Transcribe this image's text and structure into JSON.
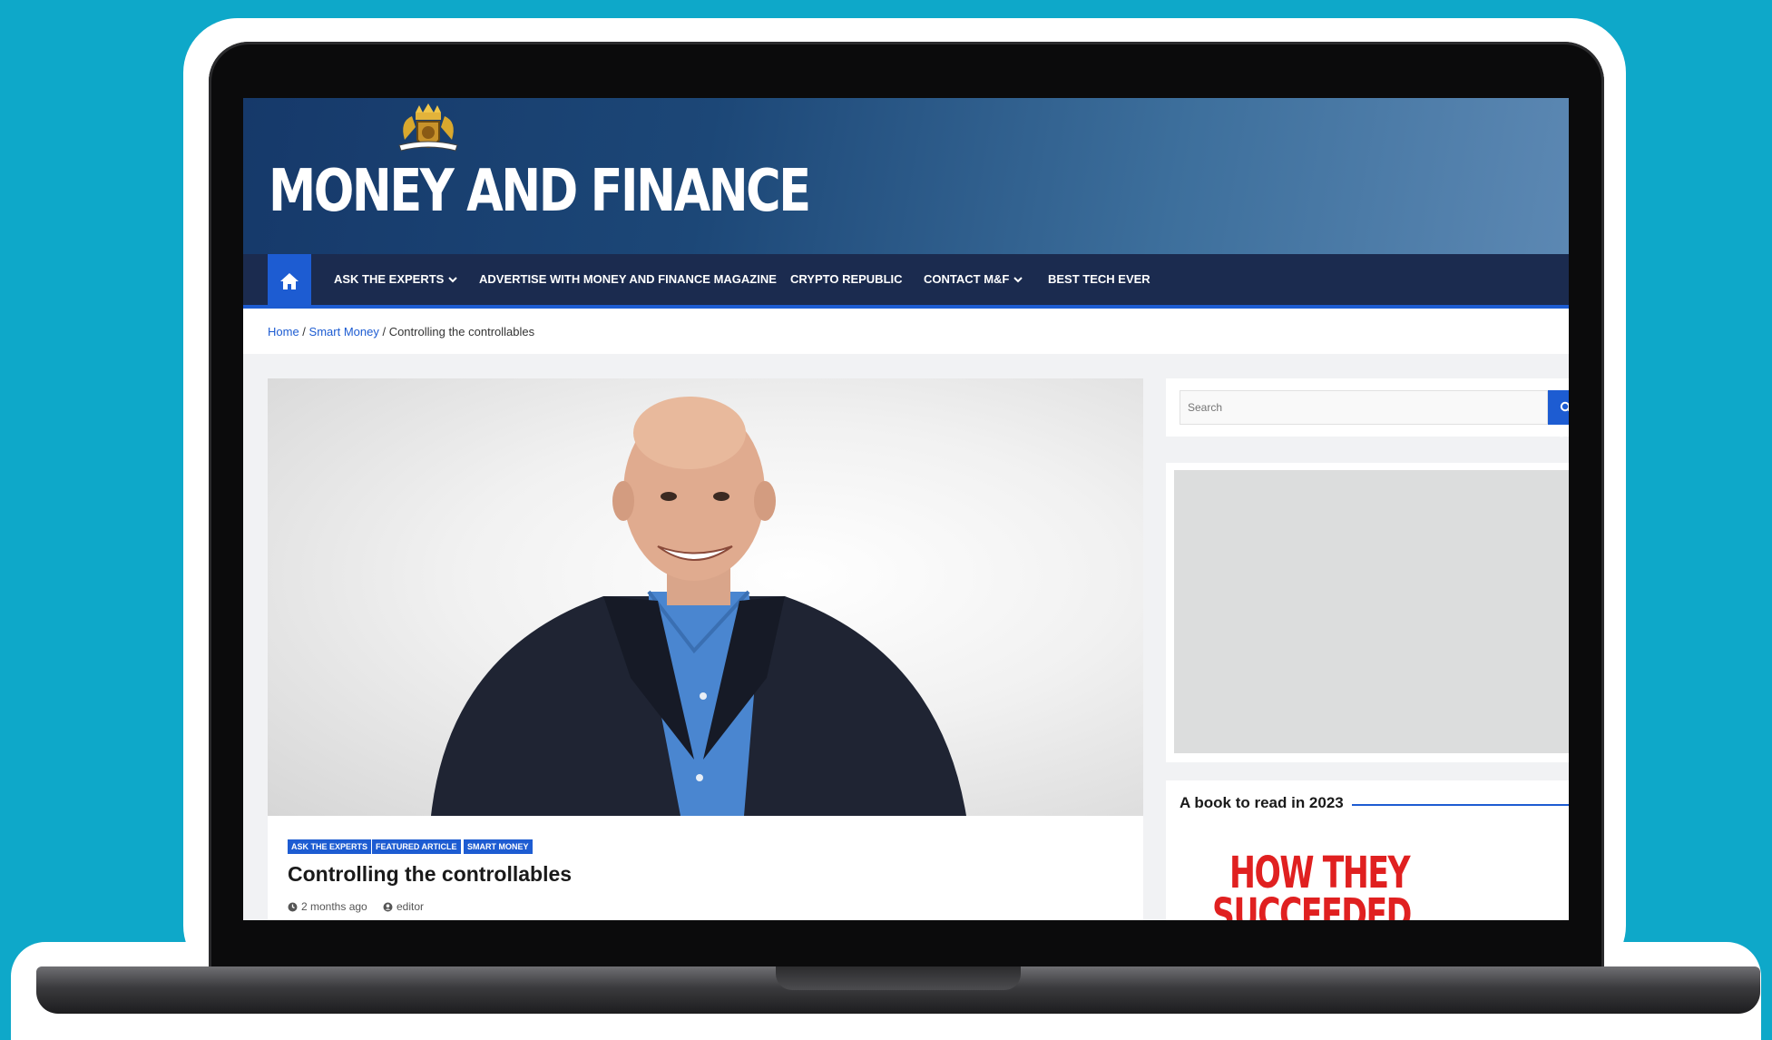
{
  "site": {
    "logo_text": "MONEY AND FINANCE"
  },
  "nav": {
    "home_icon": "home-icon",
    "items": [
      {
        "label": "ASK THE EXPERTS",
        "dropdown": true
      },
      {
        "label": "ADVERTISE WITH MONEY AND FINANCE MAGAZINE",
        "dropdown": false
      },
      {
        "label": "CRYPTO REPUBLIC",
        "dropdown": false
      },
      {
        "label": "CONTACT M&F",
        "dropdown": true
      },
      {
        "label": "BEST TECH EVER",
        "dropdown": false
      }
    ]
  },
  "breadcrumb": {
    "home": "Home",
    "sep1": " / ",
    "category": "Smart Money",
    "sep2": " / ",
    "current": "Controlling the controllables"
  },
  "article": {
    "tags": [
      "ASK THE EXPERTS",
      "FEATURED ARTICLE",
      "SMART MONEY"
    ],
    "title": "Controlling the controllables",
    "time": "2 months ago",
    "author": "editor"
  },
  "sidebar": {
    "search_placeholder": "Search",
    "widget_title": "A book to read in 2023",
    "book_line1": "HOW THEY",
    "book_line2": "SUCCEEDED"
  },
  "colors": {
    "accent": "#1d5cd2",
    "nav_bg": "#1b2b4f",
    "page_bg": "#0ea8c9",
    "book_red": "#e02020"
  }
}
